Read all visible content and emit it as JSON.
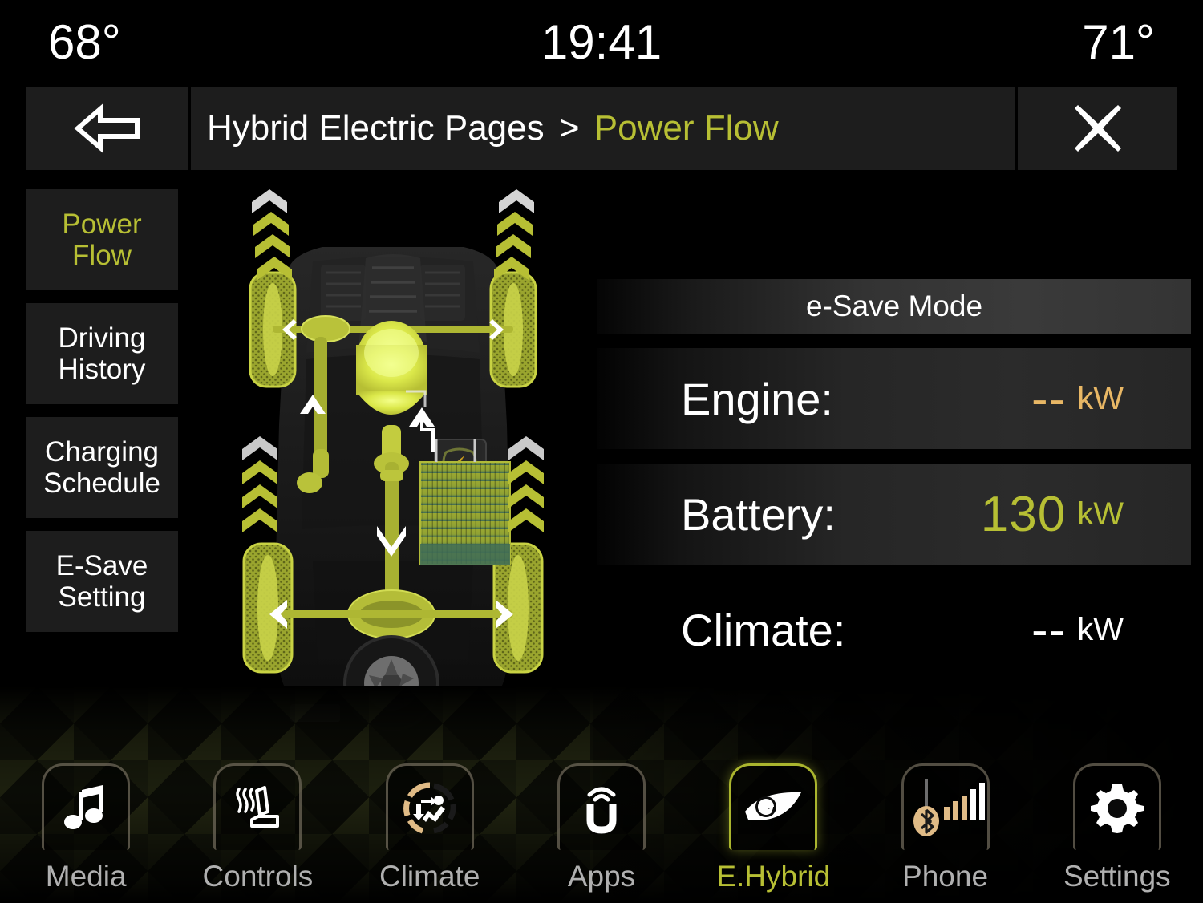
{
  "status_bar": {
    "temp_left": "68°",
    "clock": "19:41",
    "temp_right": "71°"
  },
  "title_bar": {
    "back_icon": "back-arrow-icon",
    "close_icon": "close-x-icon",
    "breadcrumb_root": "Hybrid Electric Pages",
    "breadcrumb_separator": ">",
    "breadcrumb_current": "Power Flow"
  },
  "sidebar": {
    "items": [
      {
        "line1": "Power",
        "line2": "Flow",
        "active": true
      },
      {
        "line1": "Driving",
        "line2": "History",
        "active": false
      },
      {
        "line1": "Charging",
        "line2": "Schedule",
        "active": false
      },
      {
        "line1": "E-Save",
        "line2": "Setting",
        "active": false
      }
    ]
  },
  "power_panel": {
    "mode_label": "e-Save Mode",
    "metrics": [
      {
        "label": "Engine:",
        "value": "--",
        "unit": "kW",
        "color": "#e8b765"
      },
      {
        "label": "Battery:",
        "value": "130",
        "unit": "kW",
        "color": "#b7bf34"
      },
      {
        "label": "Climate:",
        "value": "--",
        "unit": "kW",
        "color": "#ffffff"
      }
    ]
  },
  "vehicle_diagram": {
    "description": "top-down hybrid SUV power flow illustration",
    "highlight_color": "#b7bf34",
    "components": [
      "front-wheels",
      "rear-wheels",
      "electric-motor",
      "driveshaft",
      "front-differential",
      "rear-differential",
      "battery-pack",
      "engine-block",
      "power-electronics"
    ],
    "flow_arrows": [
      "front-left-forward",
      "front-right-forward",
      "rear-left-forward",
      "rear-right-forward",
      "front-axle-left",
      "front-axle-right",
      "rear-axle-left",
      "rear-axle-right",
      "motor-up",
      "driveshaft-down"
    ]
  },
  "nav_bar": {
    "items": [
      {
        "label": "Media",
        "icon": "music-note-icon",
        "active": false
      },
      {
        "label": "Controls",
        "icon": "heated-seat-icon",
        "active": false
      },
      {
        "label": "Climate",
        "icon": "climate-seat-icon",
        "active": false
      },
      {
        "label": "Apps",
        "icon": "uconnect-icon",
        "active": false
      },
      {
        "label": "E.Hybrid",
        "icon": "ehybrid-leaf-icon",
        "active": true
      },
      {
        "label": "Phone",
        "icon": "signal-bars-icon",
        "active": false
      },
      {
        "label": "Settings",
        "icon": "gear-icon",
        "active": false
      }
    ]
  },
  "colors": {
    "accent_green": "#b7bf34",
    "accent_amber": "#e8b765",
    "panel_dark": "#1d1d1d",
    "background": "#000000",
    "text_white": "#ffffff",
    "text_muted": "#b0b0b0"
  }
}
